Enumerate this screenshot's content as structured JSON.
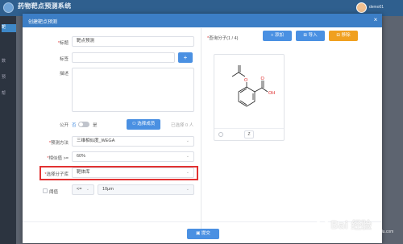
{
  "app": {
    "title": "药物靶点预测系统",
    "subtitle": "",
    "user": "demo01",
    "sidebar": [
      "靶",
      "数",
      "预",
      "帮"
    ]
  },
  "modal": {
    "title": "创建靶点预测",
    "close_glyph": "×",
    "fields": {
      "name": {
        "label": "标题",
        "value": "靶点预测"
      },
      "tag": {
        "label": "标签",
        "value": "",
        "add": "+"
      },
      "desc": {
        "label": "描述",
        "value": ""
      },
      "public": {
        "label": "公开",
        "off_text": "否",
        "on_text": "是",
        "enabled": false,
        "select_member": "选择成员",
        "selected_count": "已选择 0 人"
      },
      "method": {
        "label": "预测方法",
        "value": "三维相似度_WEGA"
      },
      "threshold": {
        "label": "相似值 >=",
        "value": "60%"
      },
      "library": {
        "label": "选择分子库",
        "value": "靶体库"
      },
      "cutoff": {
        "label": "阈值",
        "operator": "<=",
        "value": "10μm",
        "checked": false
      }
    },
    "molecule": {
      "label": "查询分子(1 / 4)",
      "add": "添加",
      "import": "导入",
      "delete": "移除",
      "atoms": {
        "O": "O",
        "OH": "OH"
      },
      "card_button": "Z"
    },
    "submit": "提交"
  },
  "watermark": {
    "text": "Bai 经验",
    "sub": "jingyan.baidu.com"
  },
  "colors": {
    "primary": "#4a90e2",
    "header": "#3c7ec6",
    "danger": "#e23232",
    "warning": "#f0a020"
  }
}
